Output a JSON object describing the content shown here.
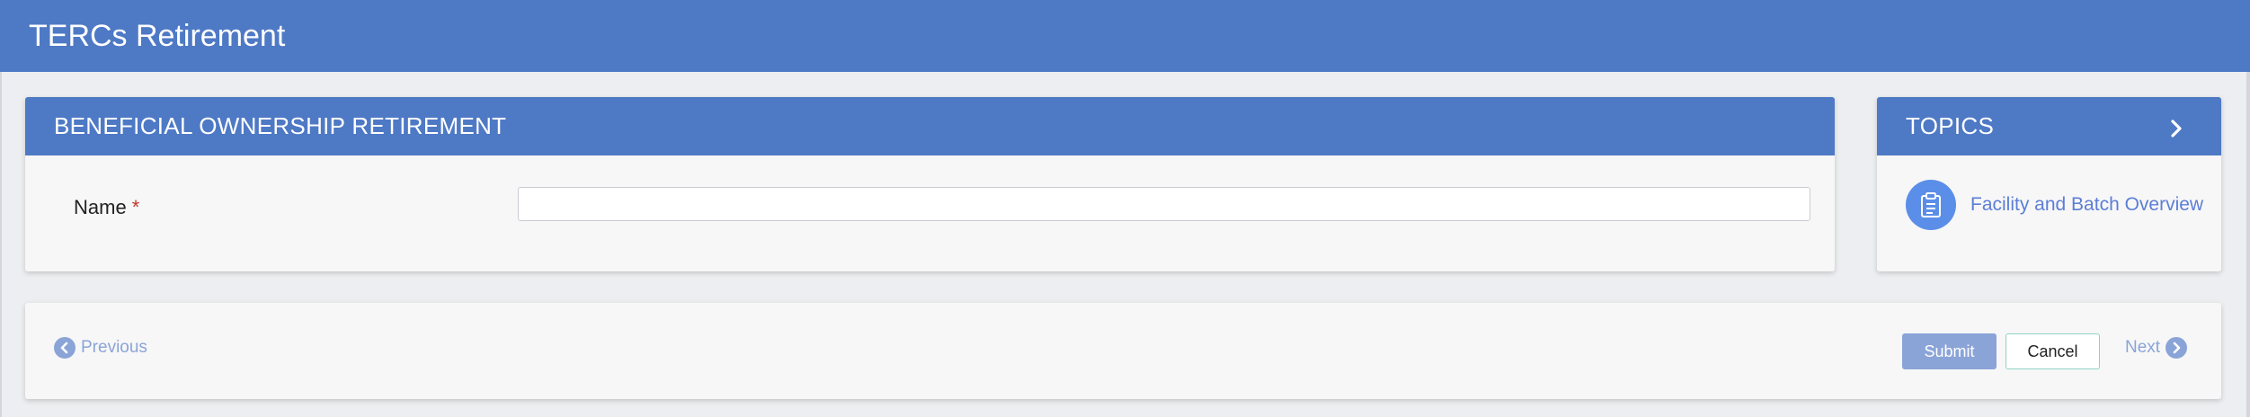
{
  "app": {
    "title": "TERCs Retirement"
  },
  "form": {
    "title": "BENEFICIAL OWNERSHIP RETIREMENT",
    "fields": [
      {
        "label": "Name",
        "required_marker": "*",
        "value": "",
        "placeholder": ""
      }
    ]
  },
  "topics": {
    "title": "TOPICS",
    "items": [
      {
        "label": "Facility and Batch Overview",
        "icon": "clipboard-icon"
      }
    ]
  },
  "navigation": {
    "previous_label": "Previous",
    "next_label": "Next",
    "submit_label": "Submit",
    "cancel_label": "Cancel"
  },
  "colors": {
    "header_blue": "#4e79c5",
    "topic_icon_blue": "#5b8ee8",
    "link_blue": "#5c7ed6",
    "disabled_blue": "#8aa4d8",
    "required_red": "#c0392b",
    "cancel_border": "#8fd3c4"
  }
}
